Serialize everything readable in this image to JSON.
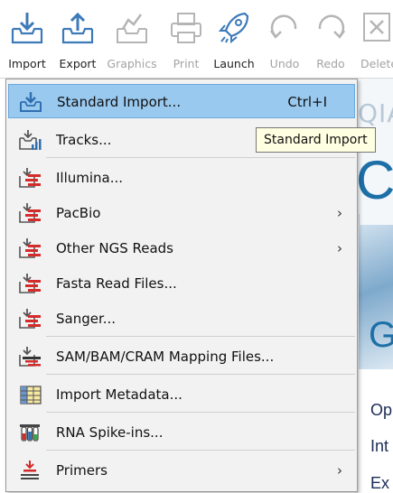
{
  "toolbar": {
    "buttons": [
      {
        "label": "Import",
        "icon": "import-icon",
        "enabled": true
      },
      {
        "label": "Export",
        "icon": "export-icon",
        "enabled": true
      },
      {
        "label": "Graphics",
        "icon": "graphics-icon",
        "enabled": false
      },
      {
        "label": "Print",
        "icon": "print-icon",
        "enabled": false
      },
      {
        "label": "Launch",
        "icon": "rocket-icon",
        "enabled": true
      },
      {
        "label": "Undo",
        "icon": "undo-icon",
        "enabled": false
      },
      {
        "label": "Redo",
        "icon": "redo-icon",
        "enabled": false
      },
      {
        "label": "Delete",
        "icon": "delete-icon",
        "enabled": false
      }
    ]
  },
  "menu": {
    "items": [
      {
        "label": "Standard Import...",
        "shortcut": "Ctrl+I",
        "icon": "standard-import-icon",
        "highlighted": true
      },
      {
        "label": "Tracks...",
        "icon": "tracks-icon"
      },
      {
        "label": "Illumina...",
        "icon": "reads-icon"
      },
      {
        "label": "PacBio",
        "icon": "reads-icon",
        "submenu": true
      },
      {
        "label": "Other NGS Reads",
        "icon": "reads-icon",
        "submenu": true
      },
      {
        "label": "Fasta Read Files...",
        "icon": "reads-icon"
      },
      {
        "label": "Sanger...",
        "icon": "reads-icon"
      },
      {
        "label": "SAM/BAM/CRAM Mapping Files...",
        "icon": "mapping-icon"
      },
      {
        "label": "Import Metadata...",
        "icon": "metadata-table-icon"
      },
      {
        "label": "RNA Spike-ins...",
        "icon": "test-tubes-icon"
      },
      {
        "label": "Primers",
        "icon": "primer-icon",
        "submenu": true
      }
    ],
    "submenu_glyph": "›"
  },
  "tooltip": {
    "text": "Standard Import"
  },
  "background": {
    "brand_fragment": "QIA",
    "big_letter": "C",
    "photo_letter": "G",
    "text_lines": [
      "Op",
      "Int",
      "Ex"
    ]
  },
  "colors": {
    "toolbar_icon": "#3d7ab8",
    "highlight": "#99c9ef",
    "reads_red": "#d42b2b",
    "tooltip_bg": "#ffffe1"
  }
}
